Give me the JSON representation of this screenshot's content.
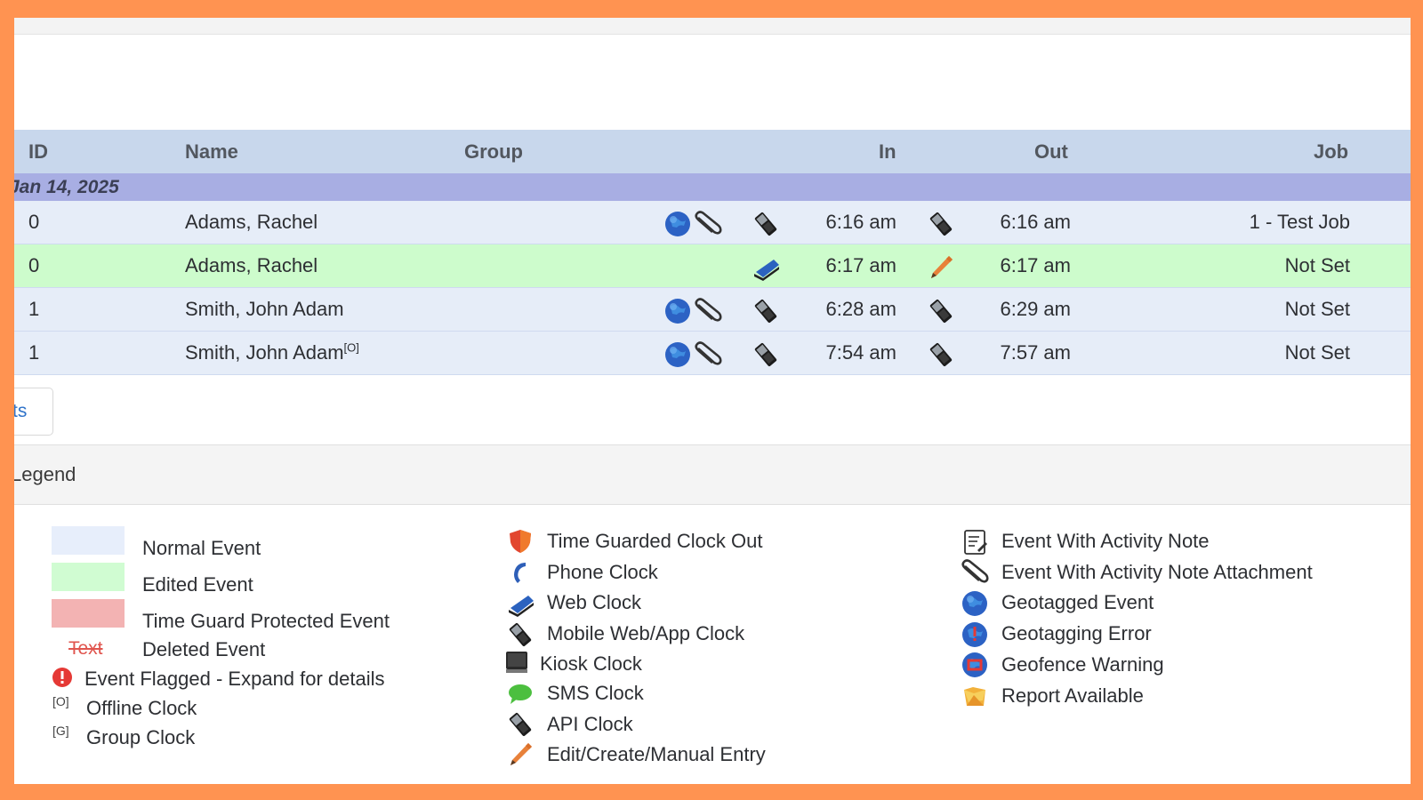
{
  "table": {
    "headers": {
      "id": "ID",
      "name": "Name",
      "group": "Group",
      "in": "In",
      "out": "Out",
      "job": "Job"
    },
    "date_group": "Jan 14, 2025",
    "rows": [
      {
        "id": "0",
        "name": "Adams, Rachel",
        "name_marker": "",
        "in": "6:16 am",
        "out": "6:16 am",
        "job": "1 - Test Job",
        "status": "normal",
        "icons": [
          "geotagged-icon",
          "attachment-icon"
        ],
        "in_icon": "mobile-clock-icon",
        "out_icon": "mobile-clock-icon"
      },
      {
        "id": "0",
        "name": "Adams, Rachel",
        "name_marker": "",
        "in": "6:17 am",
        "out": "6:17 am",
        "job": "Not Set",
        "status": "edited",
        "icons": [],
        "in_icon": "web-clock-icon",
        "out_icon": "manual-entry-icon"
      },
      {
        "id": "1",
        "name": "Smith, John Adam",
        "name_marker": "",
        "in": "6:28 am",
        "out": "6:29 am",
        "job": "Not Set",
        "status": "normal",
        "icons": [
          "geotagged-icon",
          "attachment-icon"
        ],
        "in_icon": "mobile-clock-icon",
        "out_icon": "mobile-clock-icon"
      },
      {
        "id": "1",
        "name": "Smith, John Adam",
        "name_marker": "[O]",
        "in": "7:54 am",
        "out": "7:57 am",
        "job": "Not Set",
        "status": "normal",
        "icons": [
          "geotagged-icon",
          "attachment-icon"
        ],
        "in_icon": "mobile-clock-icon",
        "out_icon": "mobile-clock-icon"
      }
    ]
  },
  "tab_button_label": "ts",
  "legend": {
    "title": "Legend",
    "colors": {
      "normal": "#e7eefb",
      "edited": "#d0fcd2",
      "time_guard": "#f3b3b3",
      "deleted_text": "#e0554e"
    },
    "col1": {
      "normal_event": "Normal Event",
      "edited_event": "Edited Event",
      "time_guard_event": "Time Guard Protected Event",
      "deleted_sample": "Text",
      "deleted_event": "Deleted Event",
      "flagged_event": "Event Flagged - Expand for details",
      "offline_marker": "[O]",
      "offline_clock": "Offline Clock",
      "group_marker": "[G]",
      "group_clock": "Group Clock"
    },
    "col2": [
      {
        "icon": "shield-icon",
        "label": "Time Guarded Clock Out"
      },
      {
        "icon": "phone-icon",
        "label": "Phone Clock"
      },
      {
        "icon": "web-clock-icon",
        "label": "Web Clock"
      },
      {
        "icon": "mobile-clock-icon",
        "label": "Mobile Web/App Clock"
      },
      {
        "icon": "kiosk-icon",
        "label": "Kiosk Clock"
      },
      {
        "icon": "sms-icon",
        "label": "SMS Clock"
      },
      {
        "icon": "api-clock-icon",
        "label": "API Clock"
      },
      {
        "icon": "manual-entry-icon",
        "label": "Edit/Create/Manual Entry"
      }
    ],
    "col3": [
      {
        "icon": "activity-note-icon",
        "label": "Event With Activity Note"
      },
      {
        "icon": "attachment-icon",
        "label": "Event With Activity Note Attachment"
      },
      {
        "icon": "geotagged-icon",
        "label": "Geotagged Event"
      },
      {
        "icon": "geotag-error-icon",
        "label": "Geotagging Error"
      },
      {
        "icon": "geofence-warning-icon",
        "label": "Geofence Warning"
      },
      {
        "icon": "report-icon",
        "label": "Report Available"
      }
    ]
  }
}
